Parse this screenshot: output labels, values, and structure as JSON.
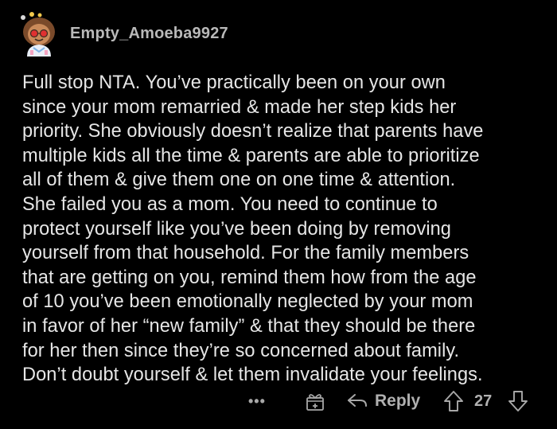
{
  "comment": {
    "username": "Empty_Amoeba9927",
    "lines": [
      "Full stop NTA. You’ve practically been on your own",
      "since your mom remarried & made her step kids her",
      "priority. She obviously doesn’t realize that parents have",
      "multiple kids all the time & parents are able to prioritize",
      "all of them & give them one on one time & attention.",
      "She failed you as a mom. You need to continue to",
      "protect yourself like you’ve been doing by removing",
      "yourself from that household. For the family members",
      "that are getting on you, remind them how from the age",
      "of 10 you’ve been emotionally neglected by your mom",
      "in favor of her “new family” & that they should be there",
      "for her then since they’re so concerned about family.",
      "Don’t doubt yourself & let them invalidate your feelings."
    ]
  },
  "actions": {
    "more_label": "•••",
    "reply_label": "Reply",
    "score": "27"
  },
  "colors": {
    "background": "#000000",
    "text": "#e6e6e6",
    "muted": "#a8a8a8"
  },
  "icons": {
    "more": "ellipsis-icon",
    "award": "gift-award-icon",
    "reply": "reply-arrow-icon",
    "upvote": "upvote-arrow-icon",
    "downvote": "downvote-arrow-icon"
  }
}
